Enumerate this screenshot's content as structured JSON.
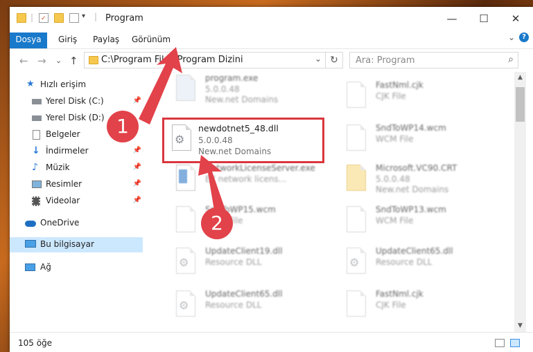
{
  "window": {
    "title": "Program",
    "controls": {
      "minimize": "—",
      "maximize": "☐",
      "close": "✕"
    }
  },
  "ribbon": {
    "tabs": [
      {
        "label": "Dosya"
      },
      {
        "label": "Giriş"
      },
      {
        "label": "Paylaş"
      },
      {
        "label": "Görünüm"
      }
    ],
    "expand_icon": "⌄",
    "help": "?"
  },
  "nav": {
    "back": "←",
    "forward": "→",
    "recent": "⌄",
    "up": "↑",
    "address": "C:\\Program Files\\Program Dizini",
    "search_placeholder": "Ara: Program"
  },
  "sidebar": {
    "items": [
      {
        "label": "Hızlı erişim",
        "icon": "star-icon"
      },
      {
        "label": "Yerel Disk (C:)",
        "icon": "drive-icon"
      },
      {
        "label": "Yerel Disk (D:)",
        "icon": "drive-icon"
      },
      {
        "label": "Belgeler",
        "icon": "documents-icon"
      },
      {
        "label": "İndirmeler",
        "icon": "download-icon"
      },
      {
        "label": "Müzik",
        "icon": "music-icon"
      },
      {
        "label": "Resimler",
        "icon": "pictures-icon"
      },
      {
        "label": "Videolar",
        "icon": "video-icon"
      },
      {
        "label": "OneDrive",
        "icon": "cloud-icon"
      },
      {
        "label": "Bu bilgisayar",
        "icon": "computer-icon"
      },
      {
        "label": "Ağ",
        "icon": "network-icon"
      }
    ]
  },
  "files": {
    "left": [
      {
        "name": "program.exe",
        "line2": "5.0.0.48",
        "line3": "New.net Domains"
      },
      {
        "name": "NetworkLicenseServer.exe",
        "line2": "EY network licens...",
        "line3": ""
      },
      {
        "name": "SndToWP15.wcm",
        "line2": "WCM File",
        "line3": ""
      },
      {
        "name": "UpdateClient19.dll",
        "line2": "Resource DLL",
        "line3": ""
      },
      {
        "name": "UpdateClient65.dll",
        "line2": "Resource DLL",
        "line3": ""
      }
    ],
    "right": [
      {
        "name": "FastNml.cjk",
        "line2": "CJK File",
        "line3": ""
      },
      {
        "name": "SndToWP14.wcm",
        "line2": "WCM File",
        "line3": ""
      },
      {
        "name": "Microsoft.VC90.CRT",
        "line2": "5.0.0.48",
        "line3": "New.net Domains"
      },
      {
        "name": "SndToWP13.wcm",
        "line2": "WCM File",
        "line3": ""
      },
      {
        "name": "UpdateClient65.dll",
        "line2": "Resource DLL",
        "line3": ""
      },
      {
        "name": "FastNml.cjk",
        "line2": "CJK File",
        "line3": ""
      }
    ],
    "highlighted": {
      "name": "newdotnet5_48.dll",
      "line2": "5.0.0.48",
      "line3": "New.net Domains"
    }
  },
  "status": {
    "count": "105 öğe"
  },
  "annotations": {
    "badge1": "1",
    "badge2": "2",
    "color": "#e2424a"
  }
}
